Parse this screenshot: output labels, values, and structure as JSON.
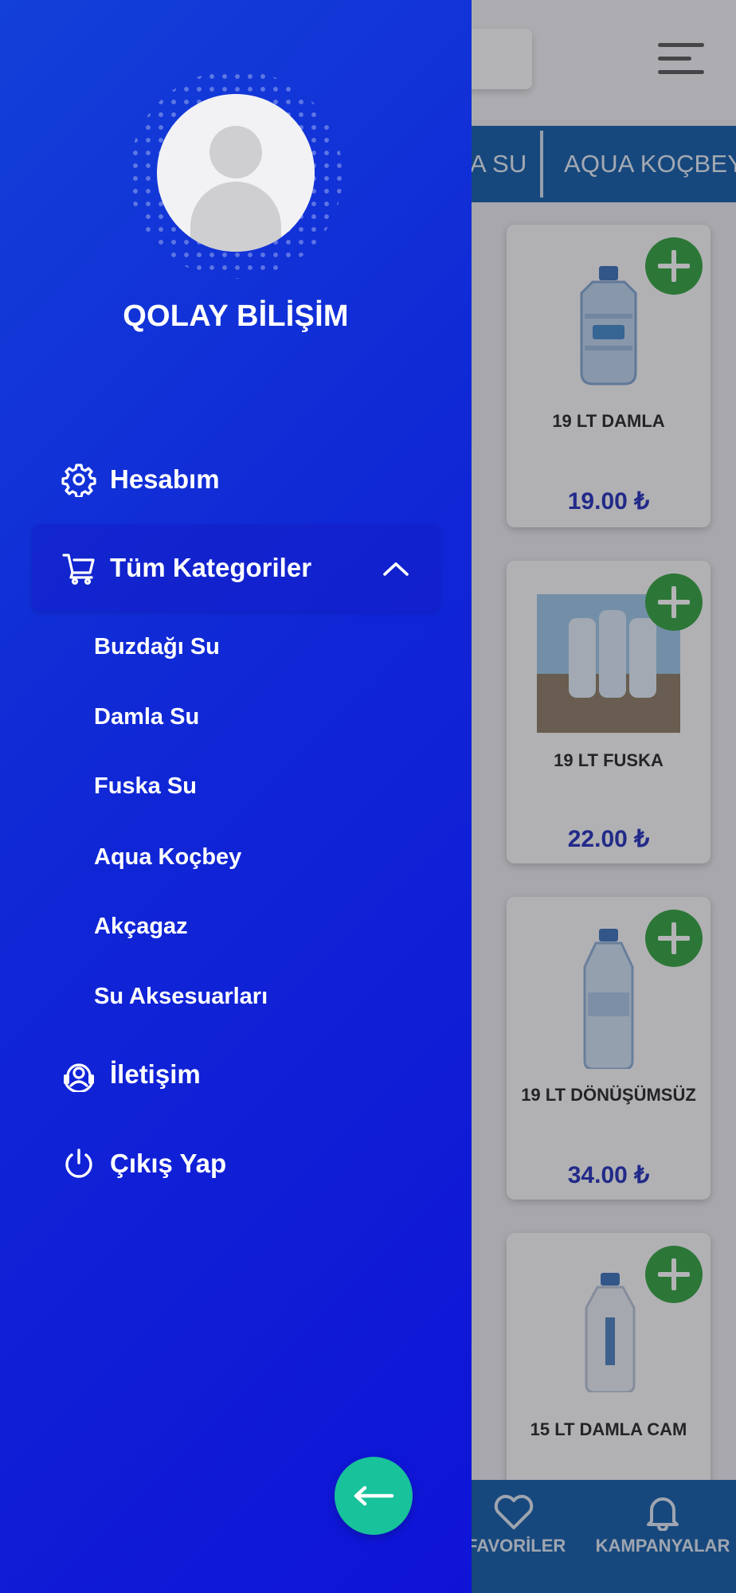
{
  "drawer": {
    "user_name": "QOLAY BİLİŞİM",
    "menu": {
      "account": "Hesabım",
      "categories": "Tüm Kategoriler",
      "contact": "İletişim",
      "logout": "Çıkış Yap"
    },
    "subcategories": [
      "Buzdağı Su",
      "Damla Su",
      "Fuska Su",
      "Aqua Koçbey",
      "Akçagaz",
      "Su Aksesuarları"
    ],
    "back_icon": "arrow-left-icon"
  },
  "background": {
    "category_tabs": [
      "A SU",
      "AQUA KOÇBEY"
    ],
    "products": [
      {
        "name": "19 LT DAMLA",
        "price": "19.00 ₺"
      },
      {
        "name": "19 LT FUSKA",
        "price": "22.00 ₺"
      },
      {
        "name": "19 LT DÖNÜŞÜMSÜZ",
        "price": "34.00 ₺"
      },
      {
        "name": "15 LT DAMLA CAM",
        "price": ""
      }
    ],
    "bottom_nav": {
      "favorites": "FAVORİLER",
      "campaigns": "KAMPANYALAR"
    }
  },
  "colors": {
    "drawer": "#1027d6",
    "accent_green": "#2fa13b",
    "back_button": "#18c29b",
    "price": "#1f2bb8",
    "nav_bar": "#0f59a6"
  }
}
